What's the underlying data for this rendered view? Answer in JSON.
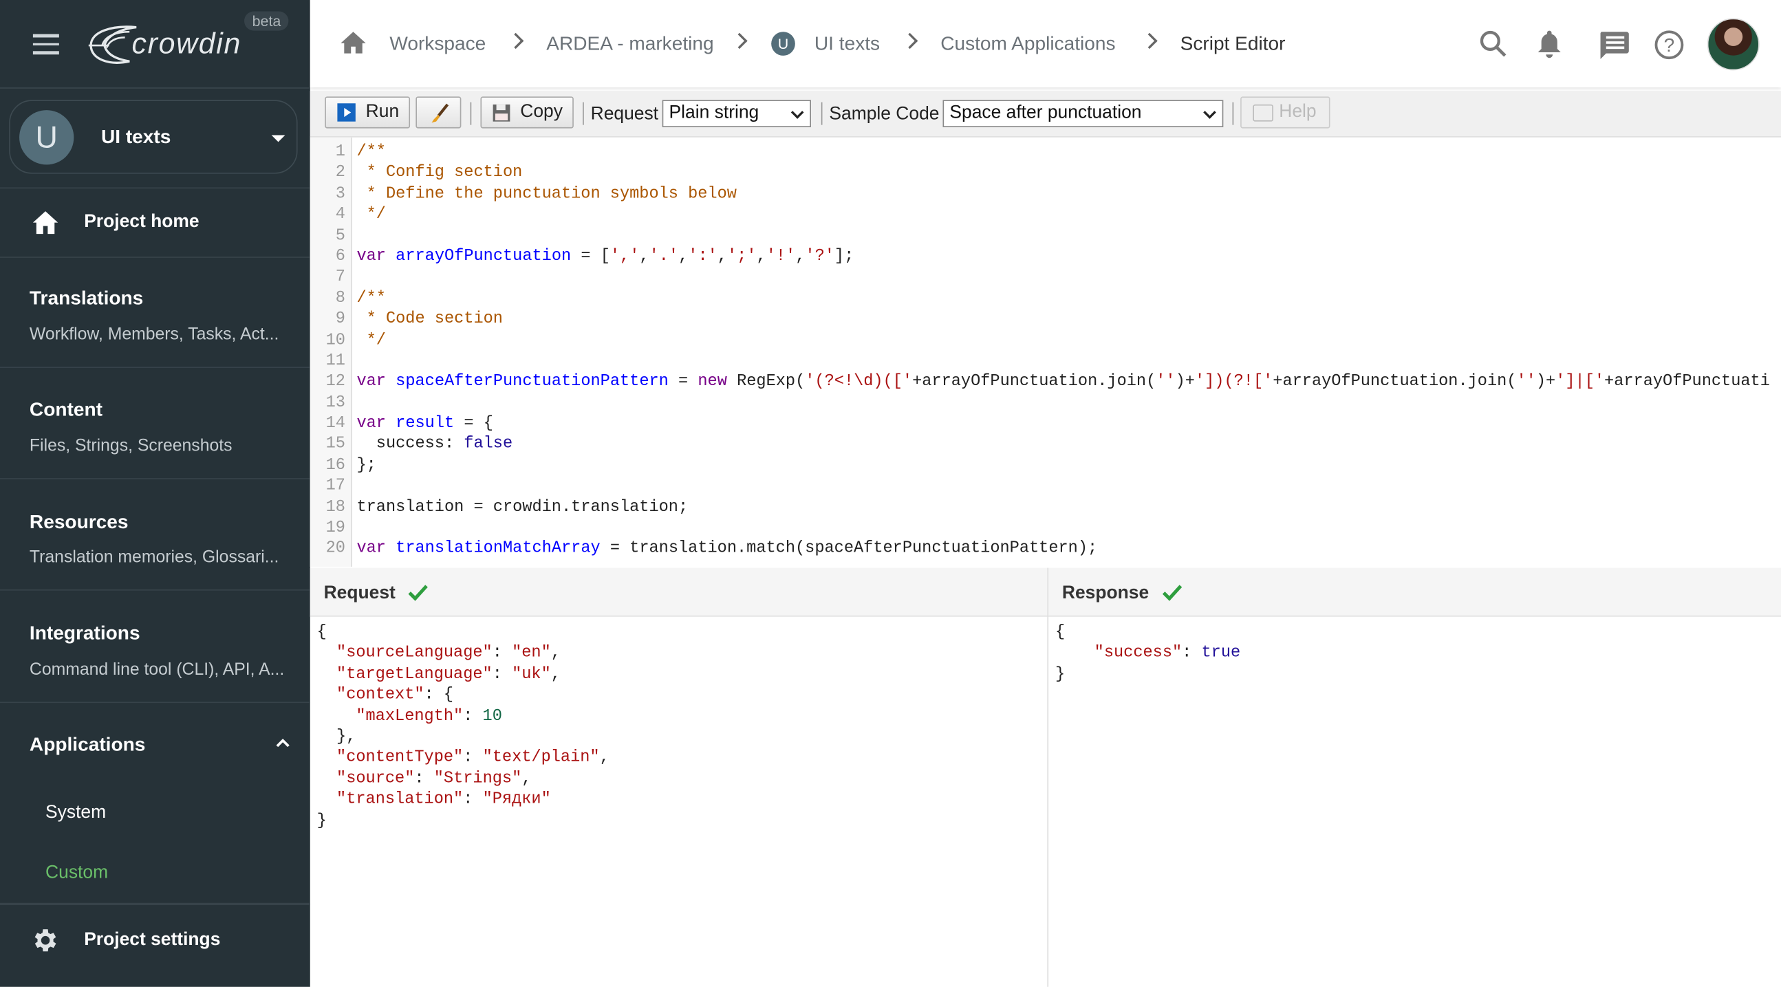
{
  "sidebar": {
    "beta_label": "beta",
    "logo_text": "crowdin",
    "project": {
      "initial": "U",
      "name": "UI texts"
    },
    "project_home": "Project home",
    "sections": [
      {
        "title": "Translations",
        "subtitle": "Workflow, Members, Tasks, Act..."
      },
      {
        "title": "Content",
        "subtitle": "Files, Strings, Screenshots"
      },
      {
        "title": "Resources",
        "subtitle": "Translation memories, Glossari..."
      },
      {
        "title": "Integrations",
        "subtitle": "Command line tool (CLI), API, A..."
      }
    ],
    "applications": {
      "title": "Applications",
      "items": [
        "System",
        "Custom"
      ],
      "active": "Custom"
    },
    "project_settings": "Project settings",
    "active_color": "#6abf69"
  },
  "breadcrumb": {
    "items": [
      "Workspace",
      "ARDEA - marketing",
      "UI texts",
      "Custom Applications",
      "Script Editor"
    ],
    "project_initial": "U"
  },
  "header_icons": [
    "search-icon",
    "bell-icon",
    "chat-icon",
    "help-icon",
    "avatar"
  ],
  "toolbar": {
    "run_label": "Run",
    "copy_label": "Copy",
    "request_label": "Request",
    "request_value": "Plain string",
    "sample_label": "Sample Code",
    "sample_value": "Space after punctuation",
    "help_label": "Help"
  },
  "code_lines": [
    [
      [
        "comment",
        "/**"
      ]
    ],
    [
      [
        "comment",
        " * Config section"
      ]
    ],
    [
      [
        "comment",
        " * Define the punctuation symbols below"
      ]
    ],
    [
      [
        "comment",
        " */"
      ]
    ],
    [],
    [
      [
        "keyword",
        "var"
      ],
      [
        "plain",
        " "
      ],
      [
        "def",
        "arrayOfPunctuation"
      ],
      [
        "plain",
        " = ["
      ],
      [
        "string",
        "','"
      ],
      [
        "plain",
        ","
      ],
      [
        "string",
        "'.'"
      ],
      [
        "plain",
        ","
      ],
      [
        "string",
        "':'"
      ],
      [
        "plain",
        ","
      ],
      [
        "string",
        "';'"
      ],
      [
        "plain",
        ","
      ],
      [
        "string",
        "'!'"
      ],
      [
        "plain",
        ","
      ],
      [
        "string",
        "'?'"
      ],
      [
        "plain",
        "];"
      ]
    ],
    [],
    [
      [
        "comment",
        "/**"
      ]
    ],
    [
      [
        "comment",
        " * Code section"
      ]
    ],
    [
      [
        "comment",
        " */"
      ]
    ],
    [],
    [
      [
        "keyword",
        "var"
      ],
      [
        "plain",
        " "
      ],
      [
        "def",
        "spaceAfterPunctuationPattern"
      ],
      [
        "plain",
        " = "
      ],
      [
        "keyword",
        "new"
      ],
      [
        "plain",
        " RegExp("
      ],
      [
        "string",
        "'(?<!\\d)(['"
      ],
      [
        "plain",
        "+arrayOfPunctuation.join("
      ],
      [
        "string",
        "''"
      ],
      [
        "plain",
        ")+"
      ],
      [
        "string",
        "'])(?!['"
      ],
      [
        "plain",
        "+arrayOfPunctuation.join("
      ],
      [
        "string",
        "''"
      ],
      [
        "plain",
        ")+"
      ],
      [
        "string",
        "']|['"
      ],
      [
        "plain",
        "+arrayOfPunctuati"
      ]
    ],
    [],
    [
      [
        "keyword",
        "var"
      ],
      [
        "plain",
        " "
      ],
      [
        "def",
        "result"
      ],
      [
        "plain",
        " = {"
      ]
    ],
    [
      [
        "plain",
        "  success: "
      ],
      [
        "atom",
        "false"
      ]
    ],
    [
      [
        "plain",
        "};"
      ]
    ],
    [],
    [
      [
        "plain",
        "translation = crowdin.translation;"
      ]
    ],
    [],
    [
      [
        "keyword",
        "var"
      ],
      [
        "plain",
        " "
      ],
      [
        "def",
        "translationMatchArray"
      ],
      [
        "plain",
        " = translation.match(spaceAfterPunctuationPattern);"
      ]
    ]
  ],
  "request_pane": {
    "title": "Request",
    "lines": [
      [
        [
          "plain",
          "{"
        ]
      ],
      [
        [
          "plain",
          "  "
        ],
        [
          "string",
          "\"sourceLanguage\""
        ],
        [
          "plain",
          ": "
        ],
        [
          "string",
          "\"en\""
        ],
        [
          "plain",
          ","
        ]
      ],
      [
        [
          "plain",
          "  "
        ],
        [
          "string",
          "\"targetLanguage\""
        ],
        [
          "plain",
          ": "
        ],
        [
          "string",
          "\"uk\""
        ],
        [
          "plain",
          ","
        ]
      ],
      [
        [
          "plain",
          "  "
        ],
        [
          "string",
          "\"context\""
        ],
        [
          "plain",
          ": {"
        ]
      ],
      [
        [
          "plain",
          "    "
        ],
        [
          "string",
          "\"maxLength\""
        ],
        [
          "plain",
          ": "
        ],
        [
          "number",
          "10"
        ]
      ],
      [
        [
          "plain",
          "  },"
        ]
      ],
      [
        [
          "plain",
          "  "
        ],
        [
          "string",
          "\"contentType\""
        ],
        [
          "plain",
          ": "
        ],
        [
          "string",
          "\"text/plain\""
        ],
        [
          "plain",
          ","
        ]
      ],
      [
        [
          "plain",
          "  "
        ],
        [
          "string",
          "\"source\""
        ],
        [
          "plain",
          ": "
        ],
        [
          "string",
          "\"Strings\""
        ],
        [
          "plain",
          ","
        ]
      ],
      [
        [
          "plain",
          "  "
        ],
        [
          "string",
          "\"translation\""
        ],
        [
          "plain",
          ": "
        ],
        [
          "string",
          "\"Рядки\""
        ]
      ],
      [
        [
          "plain",
          "}"
        ]
      ]
    ]
  },
  "response_pane": {
    "title": "Response",
    "lines": [
      [
        [
          "plain",
          "{"
        ]
      ],
      [
        [
          "plain",
          "    "
        ],
        [
          "string",
          "\"success\""
        ],
        [
          "plain",
          ": "
        ],
        [
          "atom",
          "true"
        ]
      ],
      [
        [
          "plain",
          "}"
        ]
      ]
    ]
  },
  "status_color": "#2e9e3e"
}
